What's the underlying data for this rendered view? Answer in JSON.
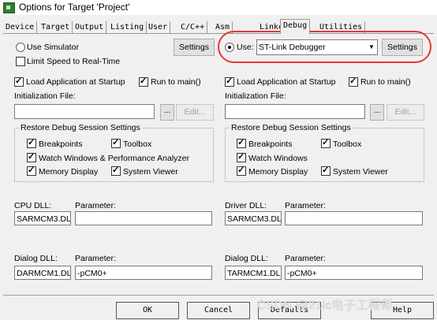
{
  "window": {
    "title": "Options for Target 'Project'"
  },
  "tabs": [
    "Device",
    "Target",
    "Output",
    "Listing",
    "User",
    "C/C++",
    "Asm",
    "Linker",
    "Debug",
    "Utilities"
  ],
  "left": {
    "use_simulator": "Use Simulator",
    "limit_speed": "Limit Speed to Real-Time",
    "settings": "Settings",
    "load_app": "Load Application at Startup",
    "run_to_main": "Run to main()",
    "init_file_label": "Initialization File:",
    "browse": "...",
    "edit": "Edit...",
    "restore_title": "Restore Debug Session Settings",
    "breakpoints": "Breakpoints",
    "toolbox": "Toolbox",
    "watch": "Watch Windows & Performance Analyzer",
    "memory": "Memory Display",
    "system_viewer": "System Viewer",
    "dll_label": "CPU DLL:",
    "param_label": "Parameter:",
    "dll_value": "SARMCM3.DLL",
    "param_value": "",
    "dialog_dll_label": "Dialog DLL:",
    "dialog_param_label": "Parameter:",
    "dialog_dll_value": "DARMCM1.DLL",
    "dialog_param_value": "-pCM0+"
  },
  "right": {
    "use_label": "Use:",
    "debugger": "ST-Link Debugger",
    "settings": "Settings",
    "load_app": "Load Application at Startup",
    "run_to_main": "Run to main()",
    "init_file_label": "Initialization File:",
    "browse": "...",
    "edit": "Edit...",
    "restore_title": "Restore Debug Session Settings",
    "breakpoints": "Breakpoints",
    "toolbox": "Toolbox",
    "watch": "Watch Windows",
    "memory": "Memory Display",
    "system_viewer": "System Viewer",
    "dll_label": "Driver DLL:",
    "param_label": "Parameter:",
    "dll_value": "SARMCM3.DLL",
    "param_value": "",
    "dialog_dll_label": "Dialog DLL:",
    "dialog_param_label": "Parameter:",
    "dialog_dll_value": "TARMCM1.DLL",
    "dialog_param_value": "-pCM0+"
  },
  "footer": {
    "ok": "OK",
    "cancel": "Cancel",
    "defaults": "Defaults",
    "help": "Help"
  },
  "watermark": "CSDN @21ic电子工程师",
  "colors": {
    "highlight_circle": "#e53935",
    "window_bg": "#f0f0f0"
  }
}
